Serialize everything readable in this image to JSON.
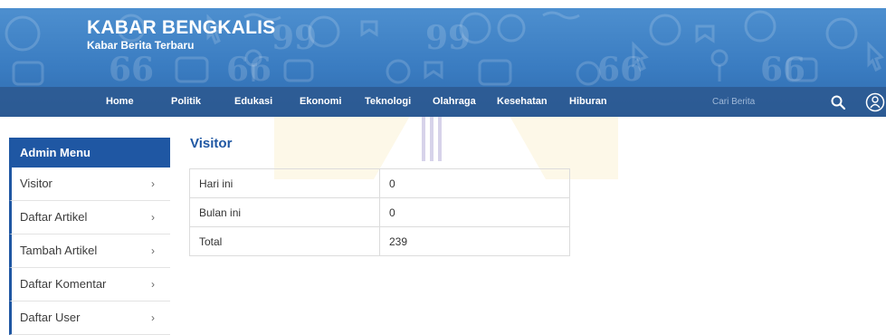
{
  "brand": {
    "title": "KABAR BENGKALIS",
    "subtitle": "Kabar Berita Terbaru"
  },
  "nav": {
    "items": [
      "Home",
      "Politik",
      "Edukasi",
      "Ekonomi",
      "Teknologi",
      "Olahraga",
      "Kesehatan",
      "Hiburan"
    ],
    "search_placeholder": "Cari Berita",
    "search_icon": "search-icon",
    "user_icon": "user-circle-icon"
  },
  "sidebar": {
    "title": "Admin Menu",
    "items": [
      {
        "label": "Visitor"
      },
      {
        "label": "Daftar Artikel"
      },
      {
        "label": "Tambah Artikel"
      },
      {
        "label": "Daftar Komentar"
      },
      {
        "label": "Daftar User"
      }
    ],
    "chevron": "›"
  },
  "main": {
    "title": "Visitor",
    "rows": [
      {
        "label": "Hari ini",
        "value": "0"
      },
      {
        "label": "Bulan ini",
        "value": "0"
      },
      {
        "label": "Total",
        "value": "239"
      }
    ]
  },
  "colors": {
    "header_blue": "#3a7cc1",
    "navbar": "#2c568c",
    "accent": "#1f57a3",
    "watermark_yellow": "#f2c200",
    "watermark_purple": "#7b68c9"
  }
}
